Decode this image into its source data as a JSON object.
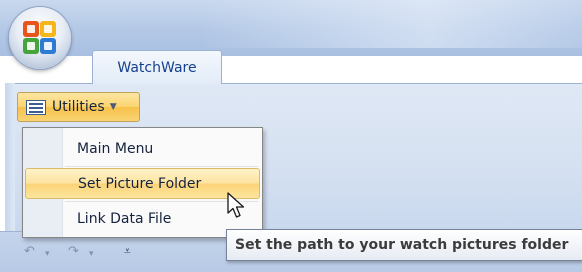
{
  "ribbon": {
    "tabs": [
      {
        "label": "WatchWare",
        "selected": true
      }
    ]
  },
  "utilities_button": {
    "label": "Utilities",
    "icon": "form-list-icon",
    "dropdown_icon": "chevron-down-icon"
  },
  "menu": {
    "items": [
      {
        "label": "Main Menu",
        "highlighted": false
      },
      {
        "label": "Set Picture Folder",
        "highlighted": true
      },
      {
        "label": "Link Data File",
        "highlighted": false
      }
    ]
  },
  "tooltip": {
    "text": "Set the path to your watch pictures folder"
  },
  "quick_access_toolbar": {
    "undo_glyph": "↶",
    "redo_glyph": "↷",
    "dropdown_glyph": "▾",
    "customize_glyph": "⩡"
  },
  "colors": {
    "highlight": "#fbd377",
    "ribbon_background": "#dfe8f5",
    "tab_text": "#15428b"
  }
}
